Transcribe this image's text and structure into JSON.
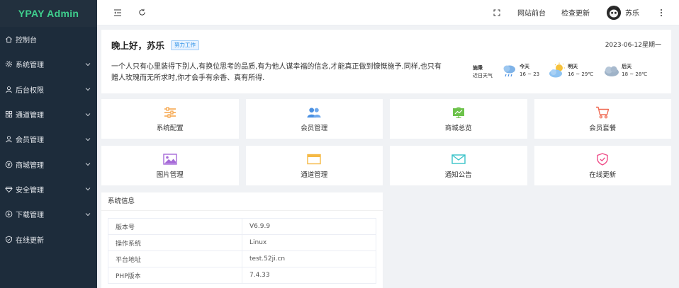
{
  "app": {
    "logo": "YPAY Admin"
  },
  "sidebar": {
    "items": [
      {
        "label": "控制台",
        "icon": "home-icon",
        "has_arrow": false
      },
      {
        "label": "系统管理",
        "icon": "gear-icon",
        "has_arrow": true
      },
      {
        "label": "后台权限",
        "icon": "user-icon",
        "has_arrow": true
      },
      {
        "label": "通道管理",
        "icon": "grid-icon",
        "has_arrow": true
      },
      {
        "label": "会员管理",
        "icon": "user-icon",
        "has_arrow": true
      },
      {
        "label": "商城管理",
        "icon": "yen-icon",
        "has_arrow": true
      },
      {
        "label": "安全管理",
        "icon": "diamond-icon",
        "has_arrow": true
      },
      {
        "label": "下载管理",
        "icon": "download-icon",
        "has_arrow": true
      },
      {
        "label": "在线更新",
        "icon": "shield-check-icon",
        "has_arrow": false
      }
    ]
  },
  "topbar": {
    "site_front": "网站前台",
    "check_update": "检查更新",
    "user_name": "苏乐"
  },
  "welcome": {
    "greeting": "晚上好，苏乐",
    "badge": "努力工作",
    "date": "2023-06-12星期一",
    "motto": "一个人只有心里装得下别人,有换位思考的品质,有为他人谋幸福的信念,才能真正做到慷慨施予.同样,也只有赠人玫瑰而无所求时,你才会手有余香、真有所得."
  },
  "weather": {
    "city": "施秉",
    "subtitle": "近日天气",
    "days": [
      {
        "name": "今天",
        "range": "16 ~ 23",
        "icon": "rain-cloud-icon"
      },
      {
        "name": "明天",
        "range": "16 ~ 29℃",
        "icon": "sun-cloud-icon"
      },
      {
        "name": "后天",
        "range": "18 ~ 28℃",
        "icon": "cloud-icon"
      }
    ]
  },
  "quick": [
    {
      "label": "系统配置",
      "icon": "sliders-icon",
      "color": "#f5a347"
    },
    {
      "label": "会员管理",
      "icon": "users-icon",
      "color": "#4a90e2"
    },
    {
      "label": "商城总览",
      "icon": "chart-board-icon",
      "color": "#6cc24a"
    },
    {
      "label": "会员套餐",
      "icon": "cart-icon",
      "color": "#f06c55"
    },
    {
      "label": "图片管理",
      "icon": "image-icon",
      "color": "#a66ad8"
    },
    {
      "label": "通道管理",
      "icon": "card-icon",
      "color": "#f5b945"
    },
    {
      "label": "通知公告",
      "icon": "mail-icon",
      "color": "#39c3c9"
    },
    {
      "label": "在线更新",
      "icon": "shield-check-icon",
      "color": "#ef4f8a"
    }
  ],
  "sysinfo": {
    "title": "系统信息",
    "rows": [
      {
        "key": "版本号",
        "value": "V6.9.9"
      },
      {
        "key": "操作系统",
        "value": "Linux"
      },
      {
        "key": "平台地址",
        "value": "test.52ji.cn"
      },
      {
        "key": "PHP版本",
        "value": "7.4.33"
      }
    ]
  }
}
